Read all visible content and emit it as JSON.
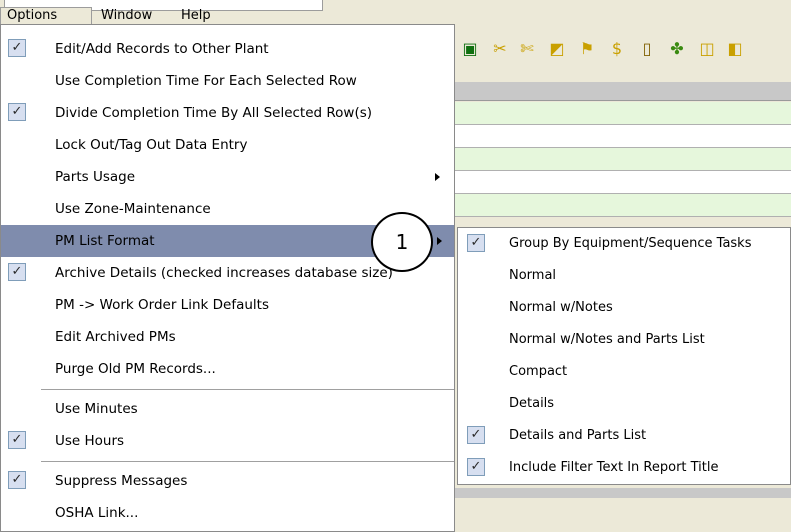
{
  "menubar": {
    "items": [
      "Options",
      "Window",
      "Help"
    ]
  },
  "toolbar": {
    "icons": [
      "chart-icon",
      "tool-icon",
      "tool2-icon",
      "graph-icon",
      "flag-icon",
      "dollar-icon",
      "file-icon",
      "puzzle-icon",
      "meter-icon",
      "bar-icon"
    ]
  },
  "main_menu": {
    "items": [
      {
        "label": "Edit/Add Records to Other Plant",
        "checked": true
      },
      {
        "label": "Use Completion Time For Each Selected Row",
        "checked": false
      },
      {
        "label": "Divide Completion Time By All Selected Row(s)",
        "checked": true
      },
      {
        "label": "Lock Out/Tag Out Data Entry",
        "checked": false
      },
      {
        "label": "Parts Usage",
        "checked": false,
        "submenu": true
      },
      {
        "label": "Use Zone-Maintenance",
        "checked": false
      },
      {
        "label": "PM List Format",
        "checked": false,
        "submenu": true,
        "highlighted": true
      },
      {
        "label": "Archive Details (checked increases database size)",
        "checked": true
      },
      {
        "label": "PM -> Work Order Link Defaults",
        "checked": false
      },
      {
        "label": "Edit Archived PMs",
        "checked": false
      },
      {
        "label": "Purge Old PM Records...",
        "checked": false
      },
      {
        "label": "Use Minutes",
        "checked": false
      },
      {
        "label": "Use Hours",
        "checked": true
      },
      {
        "label": "Suppress Messages",
        "checked": true
      },
      {
        "label": "OSHA Link...",
        "checked": false
      }
    ]
  },
  "callout": {
    "label": "1"
  },
  "sub_menu": {
    "items": [
      {
        "label": "Group By Equipment/Sequence Tasks",
        "checked": true
      },
      {
        "label": "Normal",
        "checked": false
      },
      {
        "label": "Normal w/Notes",
        "checked": false
      },
      {
        "label": "Normal w/Notes and Parts List",
        "checked": false
      },
      {
        "label": "Compact",
        "checked": false
      },
      {
        "label": "Details",
        "checked": false
      },
      {
        "label": "Details and Parts List",
        "checked": true
      },
      {
        "label": "Include Filter Text In Report Title",
        "checked": true
      }
    ]
  },
  "check_glyph": "✓",
  "colors": {
    "highlight": "#7f8cad",
    "grid_green": "#e6f7dc"
  }
}
